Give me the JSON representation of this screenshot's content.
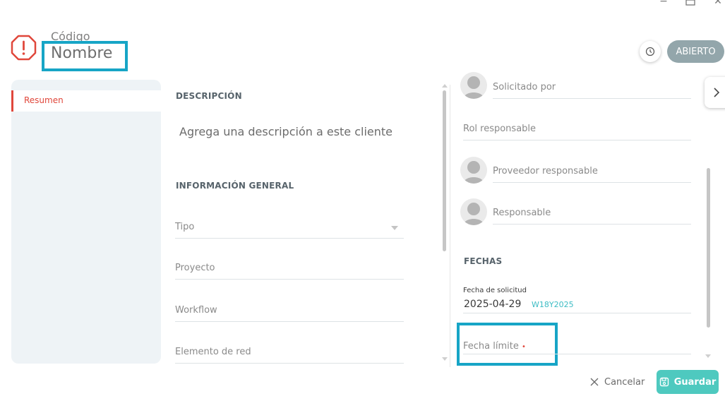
{
  "window": {
    "minimize": "−",
    "close": "✕"
  },
  "header": {
    "code_label": "Código",
    "name_label": "Nombre",
    "status": "ABIERTO"
  },
  "sidebar": {
    "items": [
      {
        "label": "Resumen",
        "active": true
      }
    ]
  },
  "main": {
    "description_title": "DESCRIPCIÓN",
    "description_placeholder": "Agrega una descripción a este cliente",
    "general_title": "INFORMACIÓN GENERAL",
    "fields": [
      "Tipo",
      "Proyecto",
      "Workflow",
      "Elemento de red"
    ]
  },
  "right": {
    "people": {
      "requested_by": "Solicitado por",
      "role_responsible": "Rol responsable",
      "provider_responsible": "Proveedor responsable",
      "responsible": "Responsable"
    },
    "dates_title": "FECHAS",
    "request_date_label": "Fecha de solicitud",
    "request_date_value": "2025-04-29",
    "request_week": "W18Y2025",
    "deadline_label": "Fecha límite",
    "deadline_required": "•"
  },
  "footer": {
    "cancel_label": "Cancelar",
    "save_label": "Guardar"
  },
  "colors": {
    "accent": "#4ec9bf",
    "danger": "#e0473b",
    "status_badge": "#93a6ab",
    "highlight": "#17a5c6"
  }
}
